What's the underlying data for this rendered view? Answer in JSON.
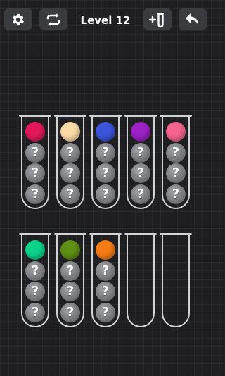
{
  "header": {
    "level_title": "Level 12",
    "buttons": [
      "settings",
      "shuffle",
      "add-tube",
      "undo"
    ]
  },
  "hidden_ball_label": "?",
  "tubes": [
    {
      "id": 1,
      "balls": [
        "#e3185a",
        "?",
        "?",
        "?"
      ]
    },
    {
      "id": 2,
      "balls": [
        "#fbdca7",
        "?",
        "?",
        "?"
      ]
    },
    {
      "id": 3,
      "balls": [
        "#3b54d9",
        "?",
        "?",
        "?"
      ]
    },
    {
      "id": 4,
      "balls": [
        "#9d21c5",
        "?",
        "?",
        "?"
      ]
    },
    {
      "id": 5,
      "balls": [
        "#f5648f",
        "?",
        "?",
        "?"
      ]
    },
    {
      "id": 6,
      "balls": [
        "#0ad38a",
        "?",
        "?",
        "?"
      ]
    },
    {
      "id": 7,
      "balls": [
        "#5f8f14",
        "?",
        "?",
        "?"
      ]
    },
    {
      "id": 8,
      "balls": [
        "#f57c15",
        "?",
        "?",
        "?"
      ]
    },
    {
      "id": 9,
      "balls": []
    },
    {
      "id": 10,
      "balls": []
    }
  ],
  "colors": {
    "button_bg": "#3a3b3f",
    "tube_outline": "#d0d3d8",
    "background": "#1f1f21"
  }
}
